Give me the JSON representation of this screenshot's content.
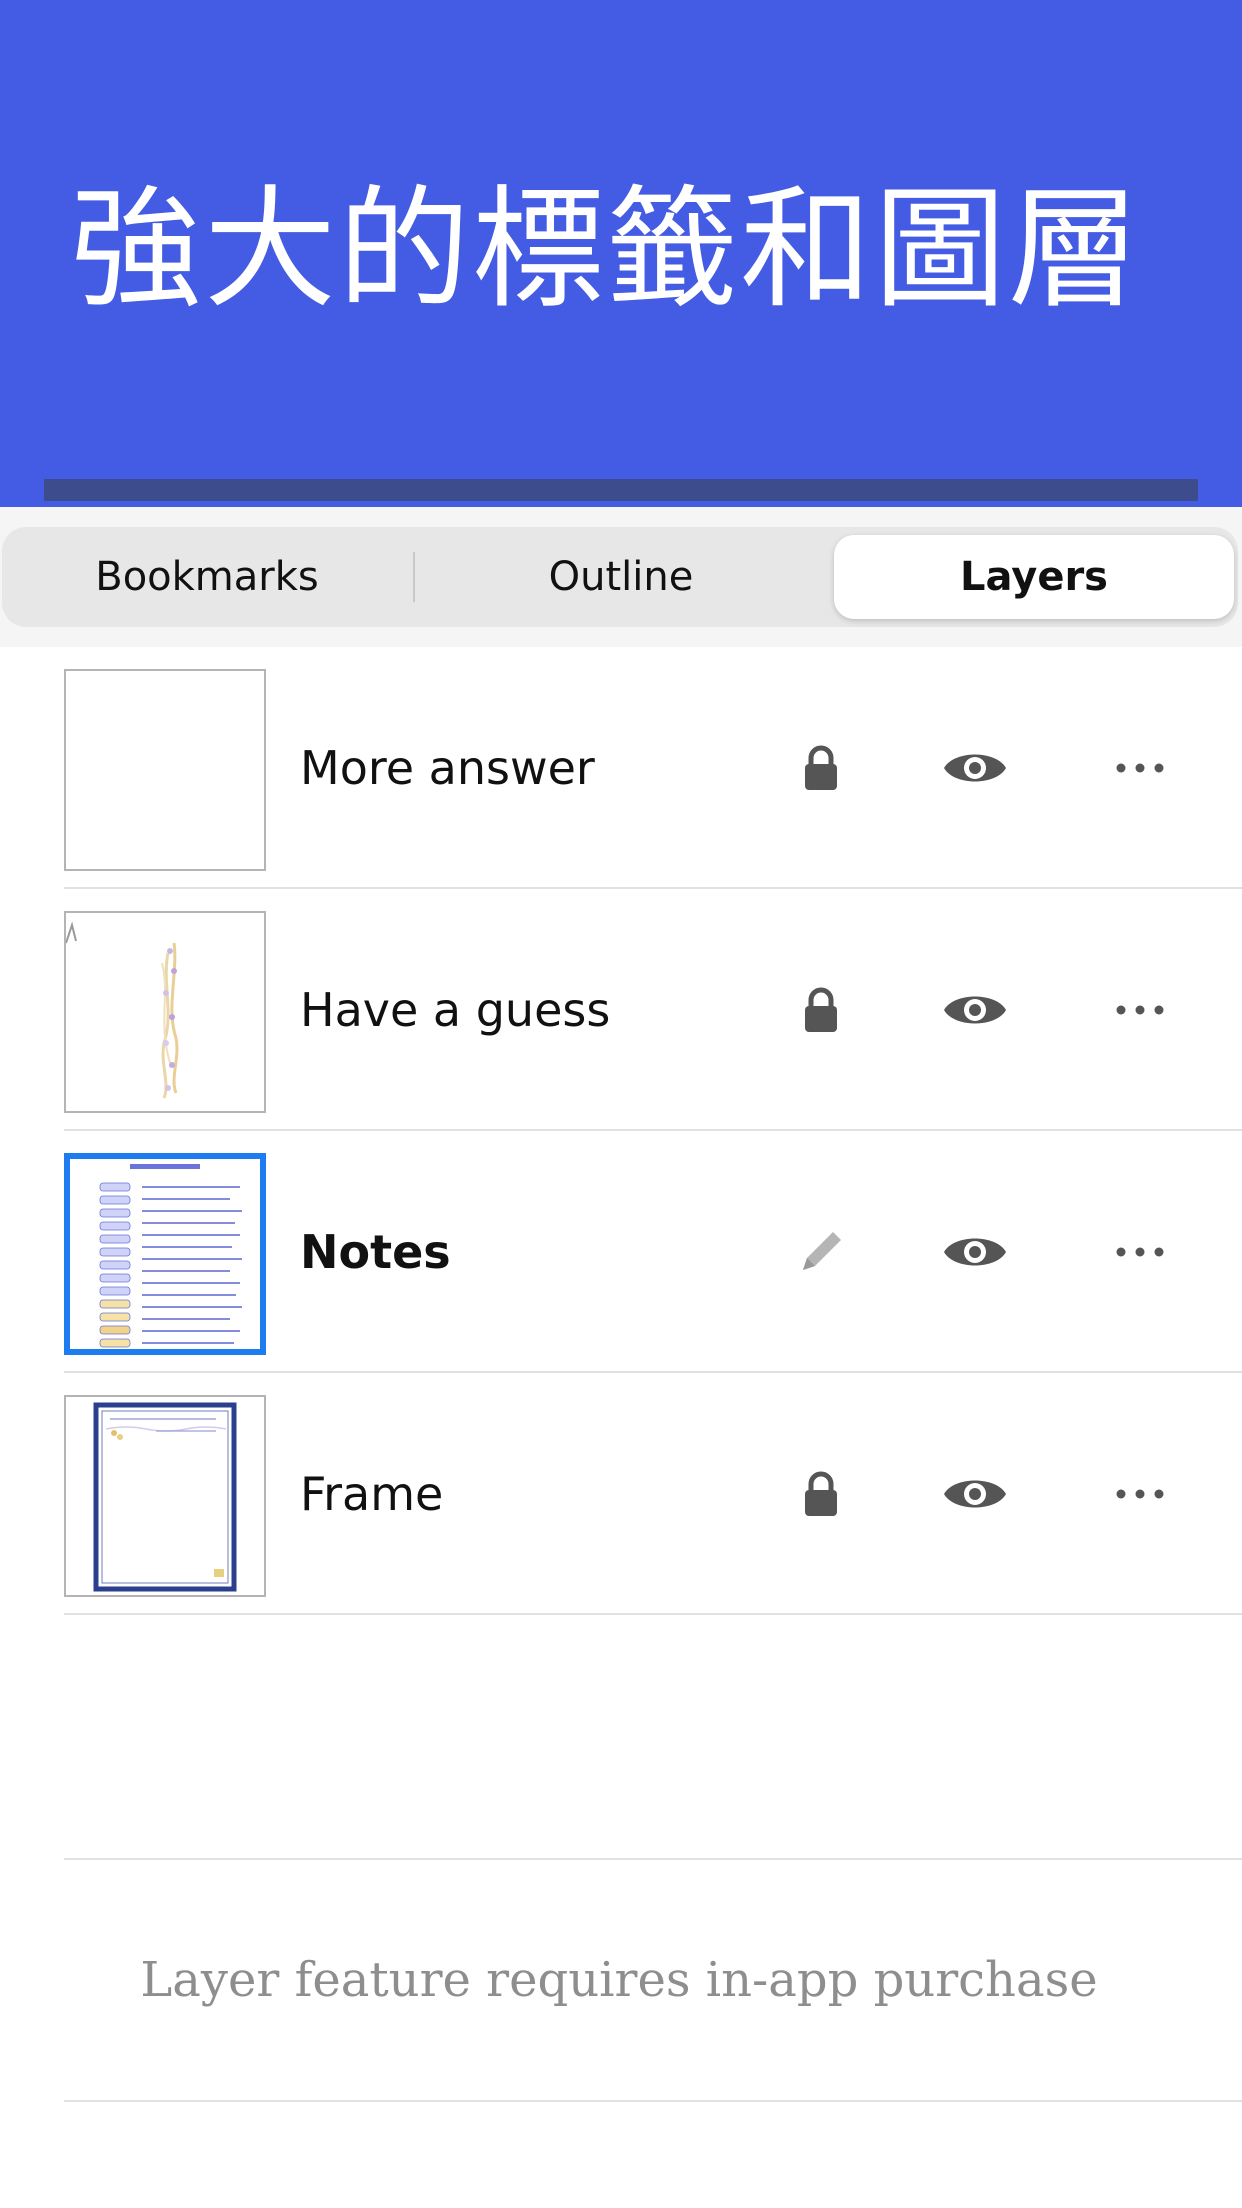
{
  "theme": {
    "accent": "#445be3",
    "selection": "#1c7cf0",
    "icon_color": "#555555"
  },
  "banner": {
    "title": "強大的標籤和圖層"
  },
  "tabs": [
    {
      "label": "Bookmarks",
      "selected": false
    },
    {
      "label": "Outline",
      "selected": false
    },
    {
      "label": "Layers",
      "selected": true
    }
  ],
  "layers": [
    {
      "name": "More answer",
      "mode": "locked",
      "mode_icon": "lock-icon",
      "visible": true,
      "selected": false,
      "thumbnail": "blank-page"
    },
    {
      "name": "Have a guess",
      "mode": "locked",
      "mode_icon": "lock-icon",
      "visible": true,
      "selected": false,
      "thumbnail": "decorations"
    },
    {
      "name": "Notes",
      "mode": "editing",
      "mode_icon": "pencil-icon",
      "visible": true,
      "selected": true,
      "thumbnail": "notes-page"
    },
    {
      "name": "Frame",
      "mode": "locked",
      "mode_icon": "lock-icon",
      "visible": true,
      "selected": false,
      "thumbnail": "frame-page"
    }
  ],
  "footer": {
    "note": "Layer feature requires in-app purchase"
  }
}
